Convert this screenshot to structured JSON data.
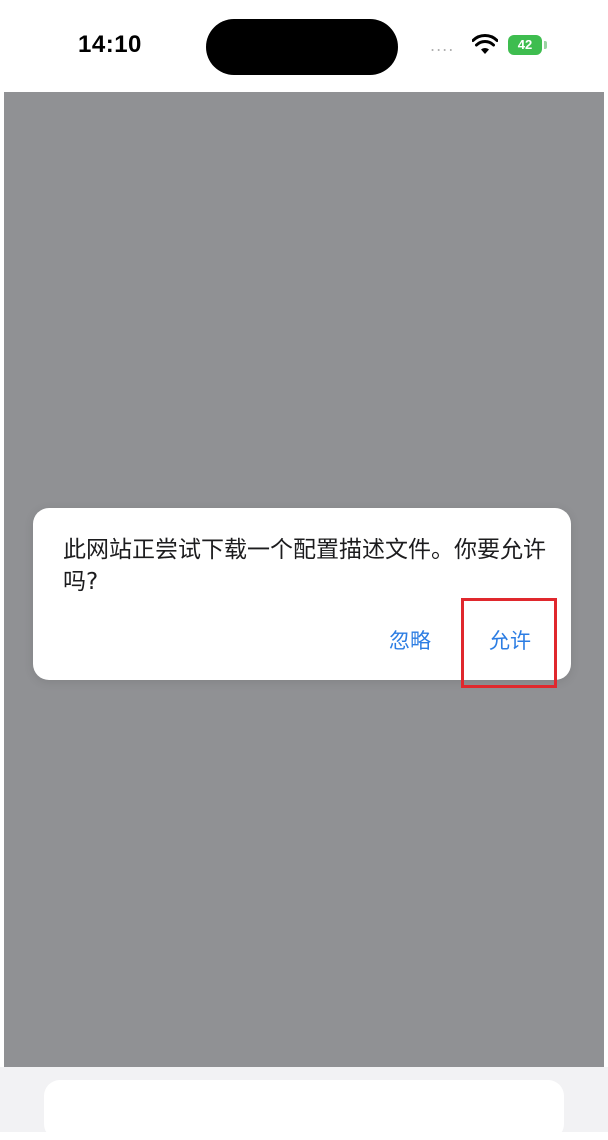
{
  "status_bar": {
    "time": "14:10",
    "signal_dots": "....",
    "battery_level": "42"
  },
  "dialog": {
    "message": "此网站正尝试下载一个配置描述文件。你要允许吗?",
    "ignore_label": "忽略",
    "allow_label": "允许"
  },
  "colors": {
    "overlay": "#909194",
    "accent_blue": "#2c7de3",
    "battery_green": "#3ebd4f",
    "highlight_red": "#e0282d"
  }
}
